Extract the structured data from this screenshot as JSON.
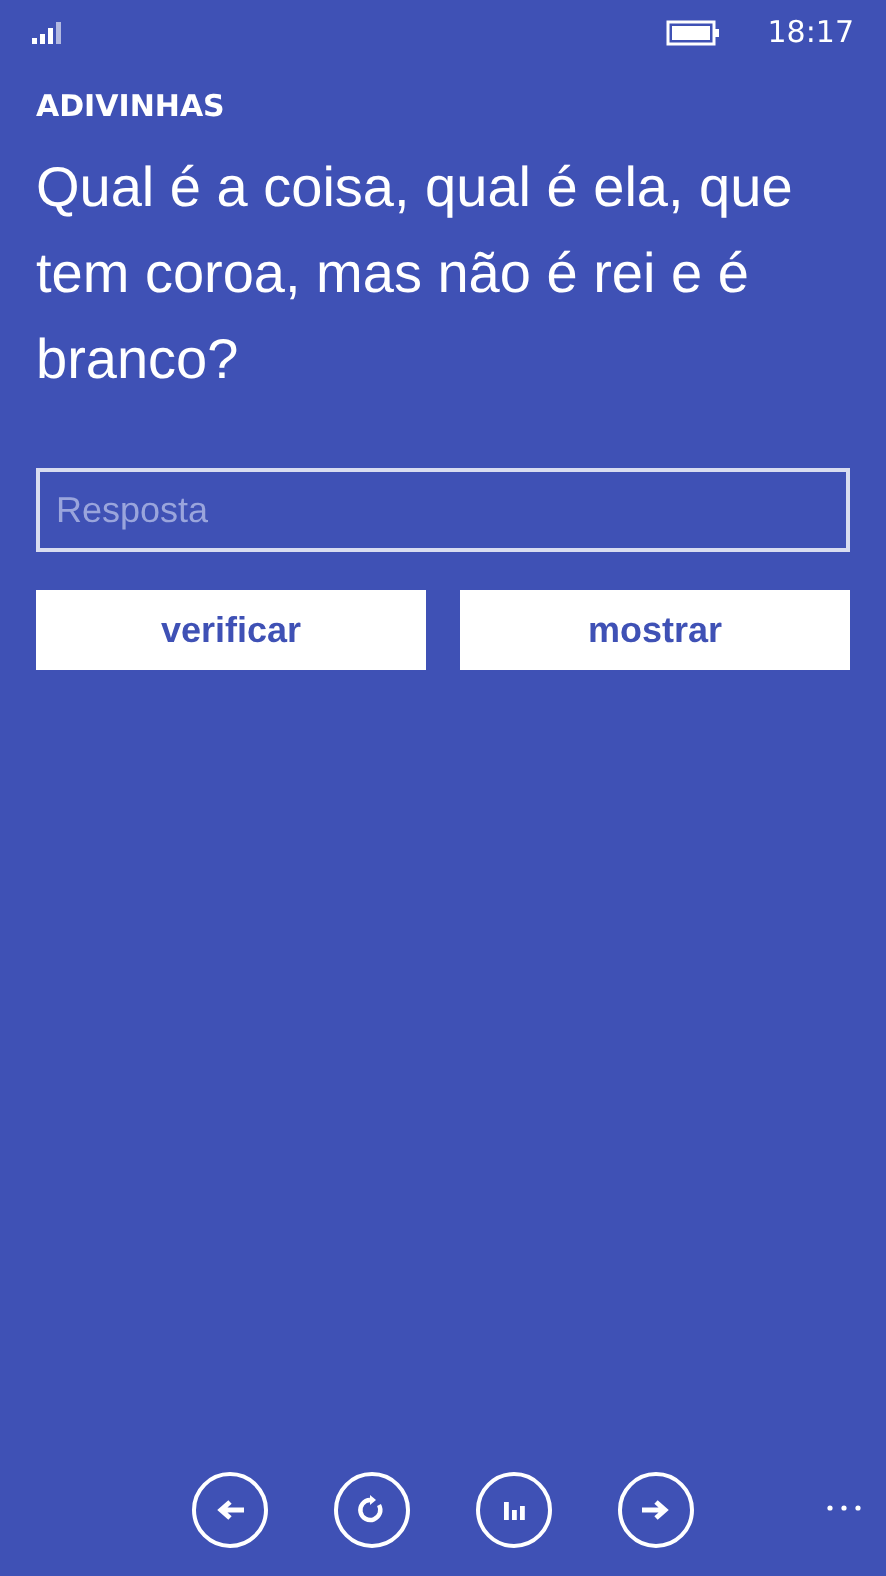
{
  "status_bar": {
    "time": "18:17"
  },
  "app_title": "ADIVINHAS",
  "question": "Qual é a coisa, qual é ela, que tem coroa, mas não é rei e é branco?",
  "answer_field": {
    "placeholder": "Resposta"
  },
  "buttons": [
    "verificar",
    "mostrar"
  ],
  "app_bar": [
    {
      "kind": "back"
    },
    {
      "kind": "refresh"
    },
    {
      "kind": "stats"
    },
    {
      "kind": "next"
    }
  ]
}
